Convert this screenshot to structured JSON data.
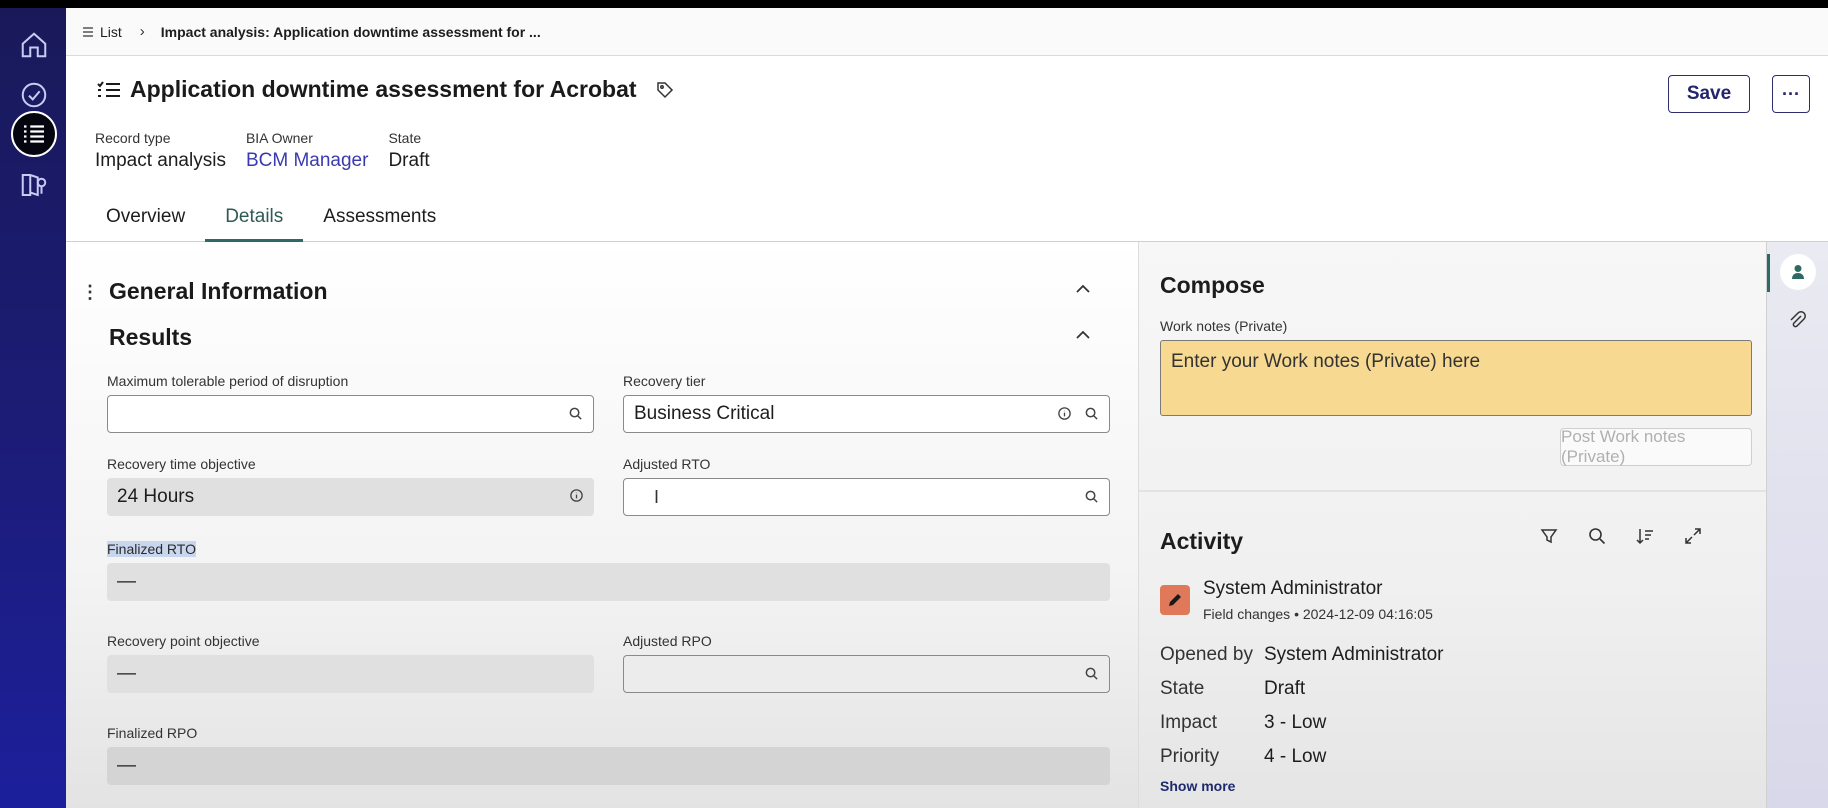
{
  "breadcrumb": {
    "list_label": "List",
    "current": "Impact analysis: Application downtime assessment for ..."
  },
  "record": {
    "title": "Application downtime assessment for Acrobat",
    "save_label": "Save",
    "more_label": "···",
    "meta": [
      {
        "label": "Record type",
        "value": "Impact analysis"
      },
      {
        "label": "BIA Owner",
        "value": "BCM Manager"
      },
      {
        "label": "State",
        "value": "Draft"
      }
    ]
  },
  "tabs": [
    {
      "label": "Overview",
      "active": false
    },
    {
      "label": "Details",
      "active": true
    },
    {
      "label": "Assessments",
      "active": false
    }
  ],
  "form": {
    "general_title": "General Information",
    "results_title": "Results",
    "fields": {
      "mtpd": {
        "label": "Maximum tolerable period of disruption",
        "value": ""
      },
      "recovery_tier": {
        "label": "Recovery tier",
        "value": "Business Critical"
      },
      "rto": {
        "label": "Recovery time objective",
        "value": "24 Hours"
      },
      "adjusted_rto": {
        "label": "Adjusted RTO",
        "value": ""
      },
      "finalized_rto": {
        "label": "Finalized RTO",
        "value": "—"
      },
      "rpo": {
        "label": "Recovery point objective",
        "value": "—"
      },
      "adjusted_rpo": {
        "label": "Adjusted RPO",
        "value": ""
      },
      "finalized_rpo": {
        "label": "Finalized RPO",
        "value": "—"
      }
    }
  },
  "compose": {
    "title": "Compose",
    "work_notes_label": "Work notes (Private)",
    "work_notes_placeholder": "Enter your Work notes (Private) here",
    "post_label": "Post Work notes (Private)"
  },
  "activity": {
    "title": "Activity",
    "entry": {
      "user": "System Administrator",
      "type": "Field changes",
      "timestamp": "2024-12-09 04:16:05",
      "changes": [
        {
          "field": "Opened by",
          "value": "System Administrator"
        },
        {
          "field": "State",
          "value": "Draft"
        },
        {
          "field": "Impact",
          "value": "3 - Low"
        },
        {
          "field": "Priority",
          "value": "4 - Low"
        }
      ]
    },
    "show_more": "Show more"
  },
  "colors": {
    "rail": "#1c1c78",
    "accent_tab": "#2e6a64",
    "link": "#3a3ab0",
    "work_notes_bg": "#f7d992",
    "activity_avatar": "#e0785a"
  }
}
